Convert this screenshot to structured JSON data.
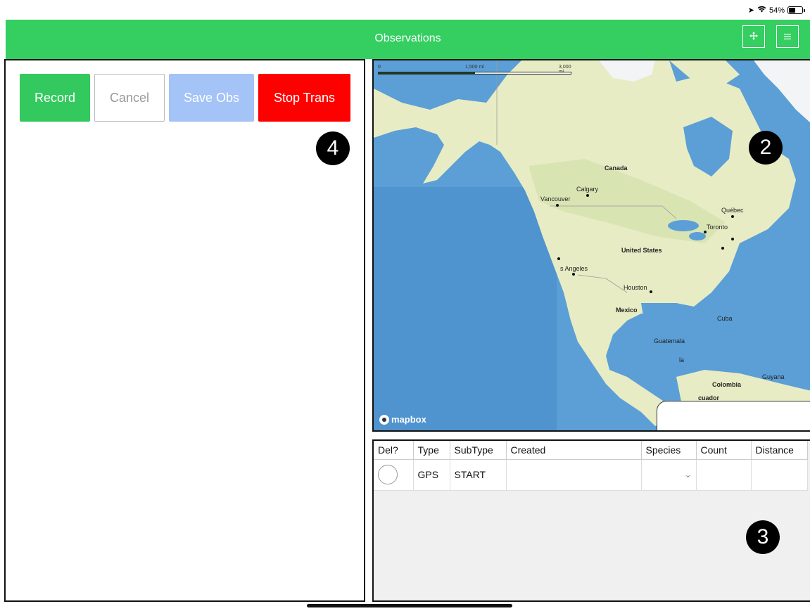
{
  "status_bar": {
    "battery_text": "54%",
    "battery_level": 0.54
  },
  "header": {
    "title": "Observations",
    "move_icon": "move-arrows-icon",
    "menu_icon": "hamburger-menu-icon"
  },
  "actions": {
    "record_label": "Record",
    "cancel_label": "Cancel",
    "save_label": "Save Obs",
    "stop_label": "Stop Trans"
  },
  "markers": {
    "left": "4",
    "map": "2",
    "table": "3"
  },
  "map": {
    "scale": {
      "zero": "0",
      "mid": "1,500 mi",
      "max": "3,000 mi"
    },
    "labels": {
      "canada": "Canada",
      "calgary": "Calgary",
      "vancouver": "Vancouver",
      "quebec": "Québec",
      "toronto": "Toronto",
      "united_states": "United States",
      "los_angeles": "s Angeles",
      "houston": "Houston",
      "mexico": "Mexico",
      "guatemala": "Guatemala",
      "cuba": "Cuba",
      "colombia": "Colombia",
      "guyana": "Guyana",
      "ecuador": "cuador",
      "la": "la"
    },
    "attribution": "mapbox",
    "colors": {
      "water": "#5b9fd6",
      "land": "#e8ecc4",
      "ice": "#f2f4f5",
      "forest": "#cfe0a8"
    }
  },
  "table": {
    "columns": [
      "Del?",
      "Type",
      "SubType",
      "Created",
      "Species",
      "Count",
      "Distance"
    ],
    "rows": [
      {
        "type": "GPS",
        "subtype": "START",
        "created": "",
        "species": "",
        "count": "",
        "distance": ""
      }
    ]
  },
  "colors": {
    "header_green": "#34ce61",
    "record_green": "#33c95e",
    "save_blue": "#a4c3f6",
    "stop_red": "#ff0000"
  }
}
